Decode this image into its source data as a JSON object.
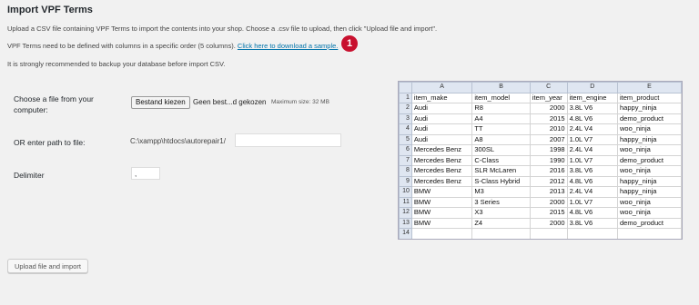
{
  "page": {
    "title": "Import VPF Terms",
    "intro_line1": "Upload a CSV file containing VPF Terms to import the contents into your shop. Choose a .csv file to upload, then click \"Upload file and import\".",
    "intro_line2_prefix": "VPF Terms need to be defined with columns in a specific order (5 columns).",
    "download_link": "Click here to download a sample.",
    "intro_line3": "It is strongly recommended to backup your database before import CSV.",
    "badge": "1"
  },
  "form": {
    "file_label": "Choose a file from your computer:",
    "file_button": "Bestand kiezen",
    "file_none": "Geen best...d gekozen",
    "max_size": "Maximum size: 32 MB",
    "path_label": "OR enter path to file:",
    "path_prefix": "C:\\xampp\\htdocs\\autorepair1/",
    "path_value": "",
    "delimiter_label": "Delimiter",
    "delimiter_value": ",",
    "upload_button": "Upload file and import"
  },
  "sheet": {
    "columns": [
      "A",
      "B",
      "C",
      "D",
      "E"
    ],
    "rows": [
      [
        "item_make",
        "item_model",
        "item_year",
        "item_engine",
        "item_product"
      ],
      [
        "Audi",
        "R8",
        "2000",
        "3.8L V6",
        "happy_ninja"
      ],
      [
        "Audi",
        "A4",
        "2015",
        "4.8L V6",
        "demo_product"
      ],
      [
        "Audi",
        "TT",
        "2010",
        "2.4L V4",
        "woo_ninja"
      ],
      [
        "Audi",
        "A8",
        "2007",
        "1.0L V7",
        "happy_ninja"
      ],
      [
        "Mercedes Benz",
        "300SL",
        "1998",
        "2.4L V4",
        "woo_ninja"
      ],
      [
        "Mercedes Benz",
        "C-Class",
        "1990",
        "1.0L V7",
        "demo_product"
      ],
      [
        "Mercedes Benz",
        "SLR McLaren",
        "2016",
        "3.8L V6",
        "woo_ninja"
      ],
      [
        "Mercedes Benz",
        "S-Class Hybrid",
        "2012",
        "4.8L V6",
        "happy_ninja"
      ],
      [
        "BMW",
        "M3",
        "2013",
        "2.4L V4",
        "happy_ninja"
      ],
      [
        "BMW",
        "3 Series",
        "2000",
        "1.0L V7",
        "woo_ninja"
      ],
      [
        "BMW",
        "X3",
        "2015",
        "4.8L V6",
        "woo_ninja"
      ],
      [
        "BMW",
        "Z4",
        "2000",
        "3.8L V6",
        "demo_product"
      ]
    ],
    "row_numbers": [
      "1",
      "2",
      "3",
      "4",
      "5",
      "6",
      "7",
      "8",
      "9",
      "10",
      "11",
      "12",
      "13",
      "14"
    ]
  }
}
